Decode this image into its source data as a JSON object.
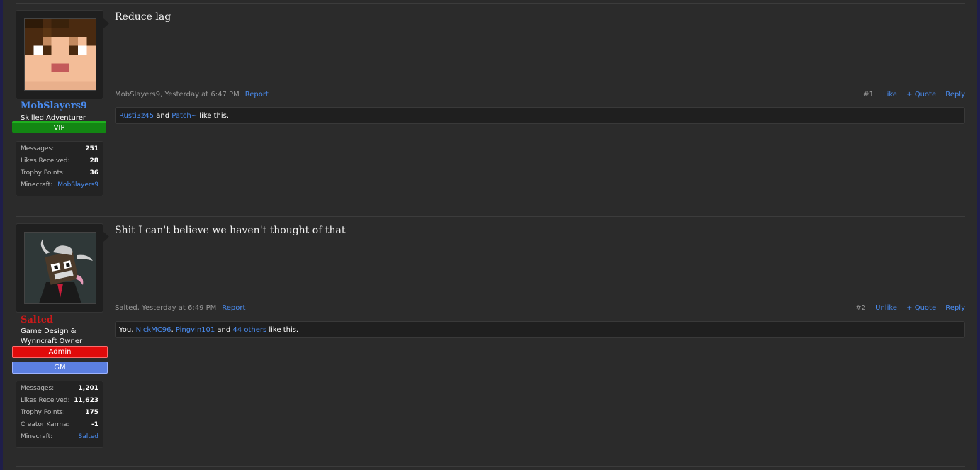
{
  "posts": [
    {
      "username": "MobSlayers9",
      "username_color": "#4a8cf0",
      "title": "Skilled Adventurer",
      "banners": [
        "VIP"
      ],
      "stats": [
        {
          "label": "Messages:",
          "value": "251"
        },
        {
          "label": "Likes Received:",
          "value": "28"
        },
        {
          "label": "Trophy Points:",
          "value": "36"
        },
        {
          "label": "Minecraft:",
          "value": "MobSlayers9"
        }
      ],
      "message": "Reduce lag",
      "meta_author": "MobSlayers9, Yesterday at 6:47 PM",
      "report": "Report",
      "post_number": "#1",
      "like_label": "Like",
      "quote_label": "+ Quote",
      "reply_label": "Reply",
      "likes": {
        "user1": "Rusti3z45",
        "sep1": " and ",
        "user2": "Patch~",
        "suffix": " like this."
      }
    },
    {
      "username": "Salted",
      "username_color": "#cc1a1a",
      "title_line1": "Game Design &",
      "title_line2": "Wynncraft Owner",
      "banners": [
        "Admin",
        "GM"
      ],
      "stats": [
        {
          "label": "Messages:",
          "value": "1,201"
        },
        {
          "label": "Likes Received:",
          "value": "11,623"
        },
        {
          "label": "Trophy Points:",
          "value": "175"
        },
        {
          "label": "Creator Karma:",
          "value": "-1"
        },
        {
          "label": "Minecraft:",
          "value": "Salted"
        }
      ],
      "message": "Shit I can't believe we haven't thought of that",
      "meta_author": "Salted, Yesterday at 6:49 PM",
      "report": "Report",
      "post_number": "#2",
      "like_label": "Unlike",
      "quote_label": "+ Quote",
      "reply_label": "Reply",
      "likes": {
        "prefix": "You, ",
        "user1": "NickMC96",
        "sep1": ", ",
        "user2": "Pingvin101",
        "sep2": " and ",
        "user3": "44 others",
        "suffix": " like this."
      }
    }
  ]
}
